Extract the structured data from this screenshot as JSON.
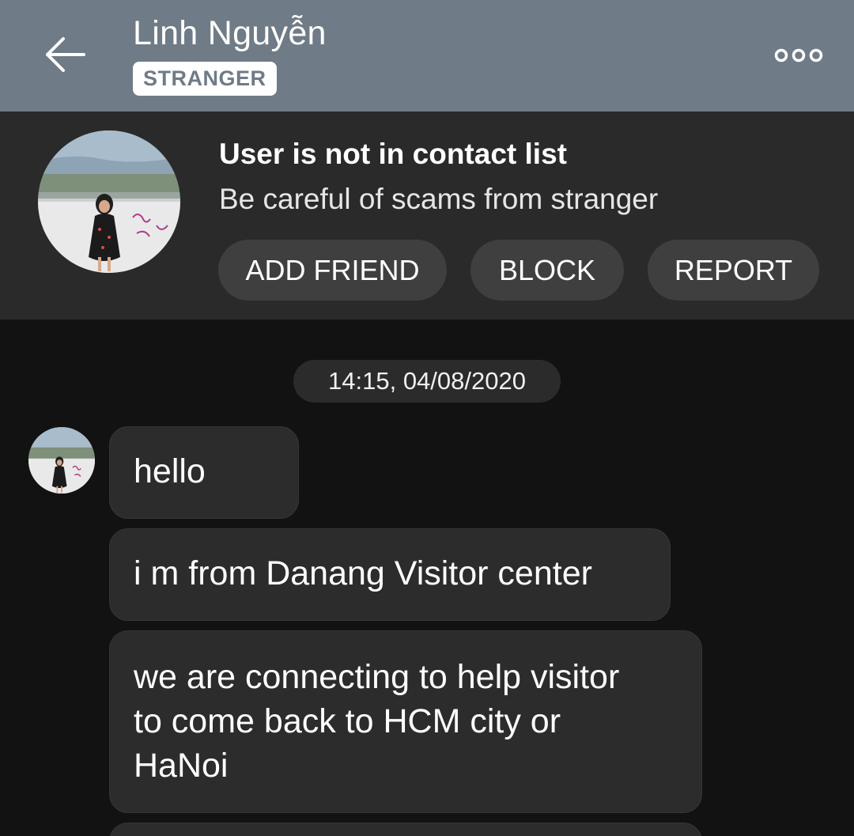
{
  "header": {
    "contact_name": "Linh Nguyễn",
    "badge": "STRANGER",
    "icons": {
      "back": "back-arrow-icon",
      "more": "more-options-icon"
    }
  },
  "banner": {
    "title": "User is not in contact list",
    "subtitle": "Be careful of scams from stranger",
    "buttons": {
      "add_friend": "ADD FRIEND",
      "block": "BLOCK",
      "report": "REPORT"
    }
  },
  "chat": {
    "timestamp": "14:15, 04/08/2020",
    "messages": [
      {
        "text": "hello"
      },
      {
        "text": "i m from Danang Visitor center"
      },
      {
        "text": "we are connecting to help visitor\nto come back to HCM city or\nHaNoi"
      },
      {
        "text": ""
      }
    ]
  },
  "colors": {
    "header_bg": "#6f7b86",
    "banner_bg": "#2a2a2a",
    "chat_bg": "#121212",
    "bubble_bg": "#2c2c2c",
    "pill_bg": "#3f3f3f"
  }
}
